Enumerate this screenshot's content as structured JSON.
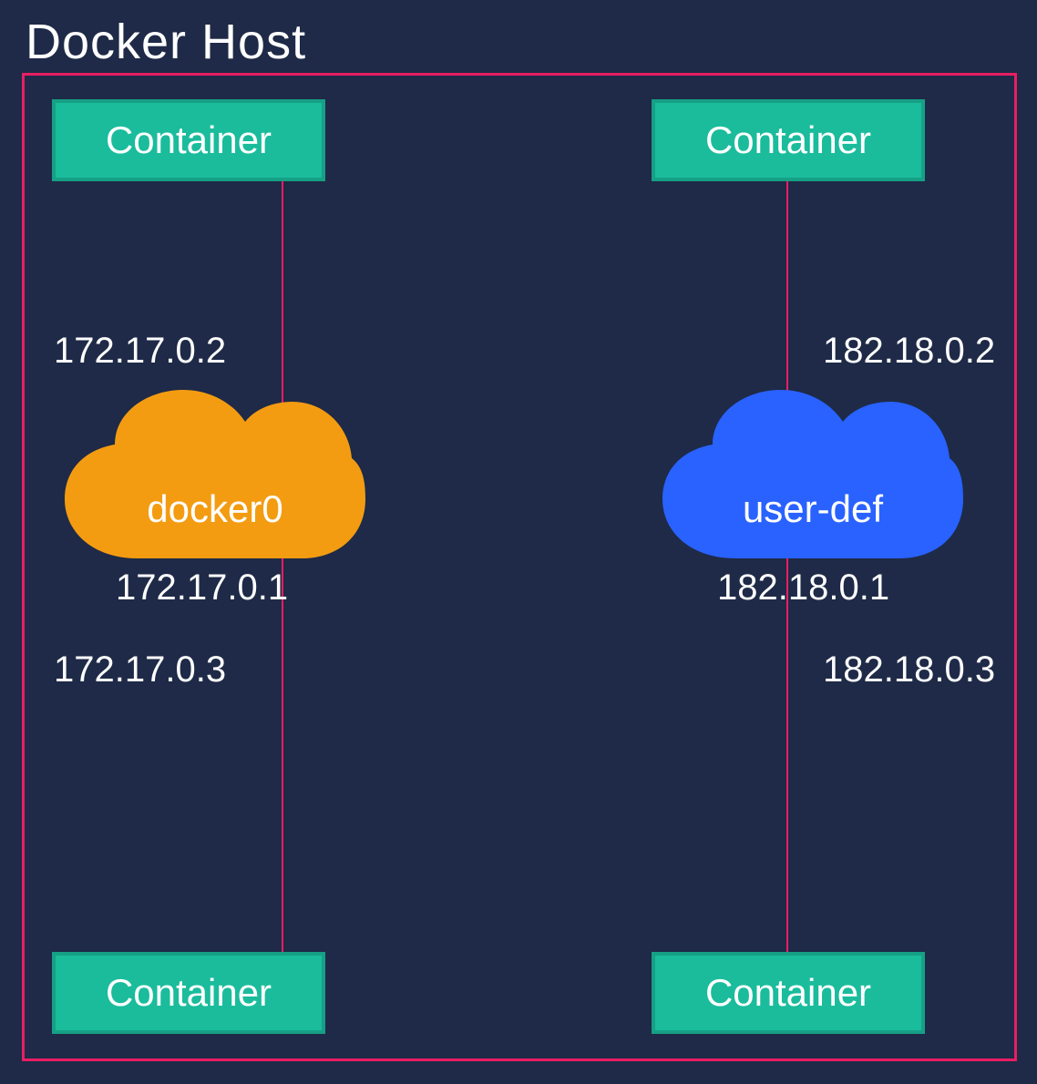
{
  "host": {
    "title": "Docker Host"
  },
  "containers": {
    "top_left": "Container",
    "top_right": "Container",
    "bottom_left": "Container",
    "bottom_right": "Container"
  },
  "networks": {
    "left": {
      "name": "docker0",
      "gateway_ip": "172.17.0.1",
      "container_top_ip": "172.17.0.2",
      "container_bottom_ip": "172.17.0.3",
      "color": "#f39c12"
    },
    "right": {
      "name": "user-def",
      "gateway_ip": "182.18.0.1",
      "container_top_ip": "182.18.0.2",
      "container_bottom_ip": "182.18.0.3",
      "color": "#2962ff"
    }
  },
  "colors": {
    "background": "#1e2a47",
    "frame_border": "#e91e63",
    "container_fill": "#1abc9c",
    "container_border": "#16a085"
  }
}
